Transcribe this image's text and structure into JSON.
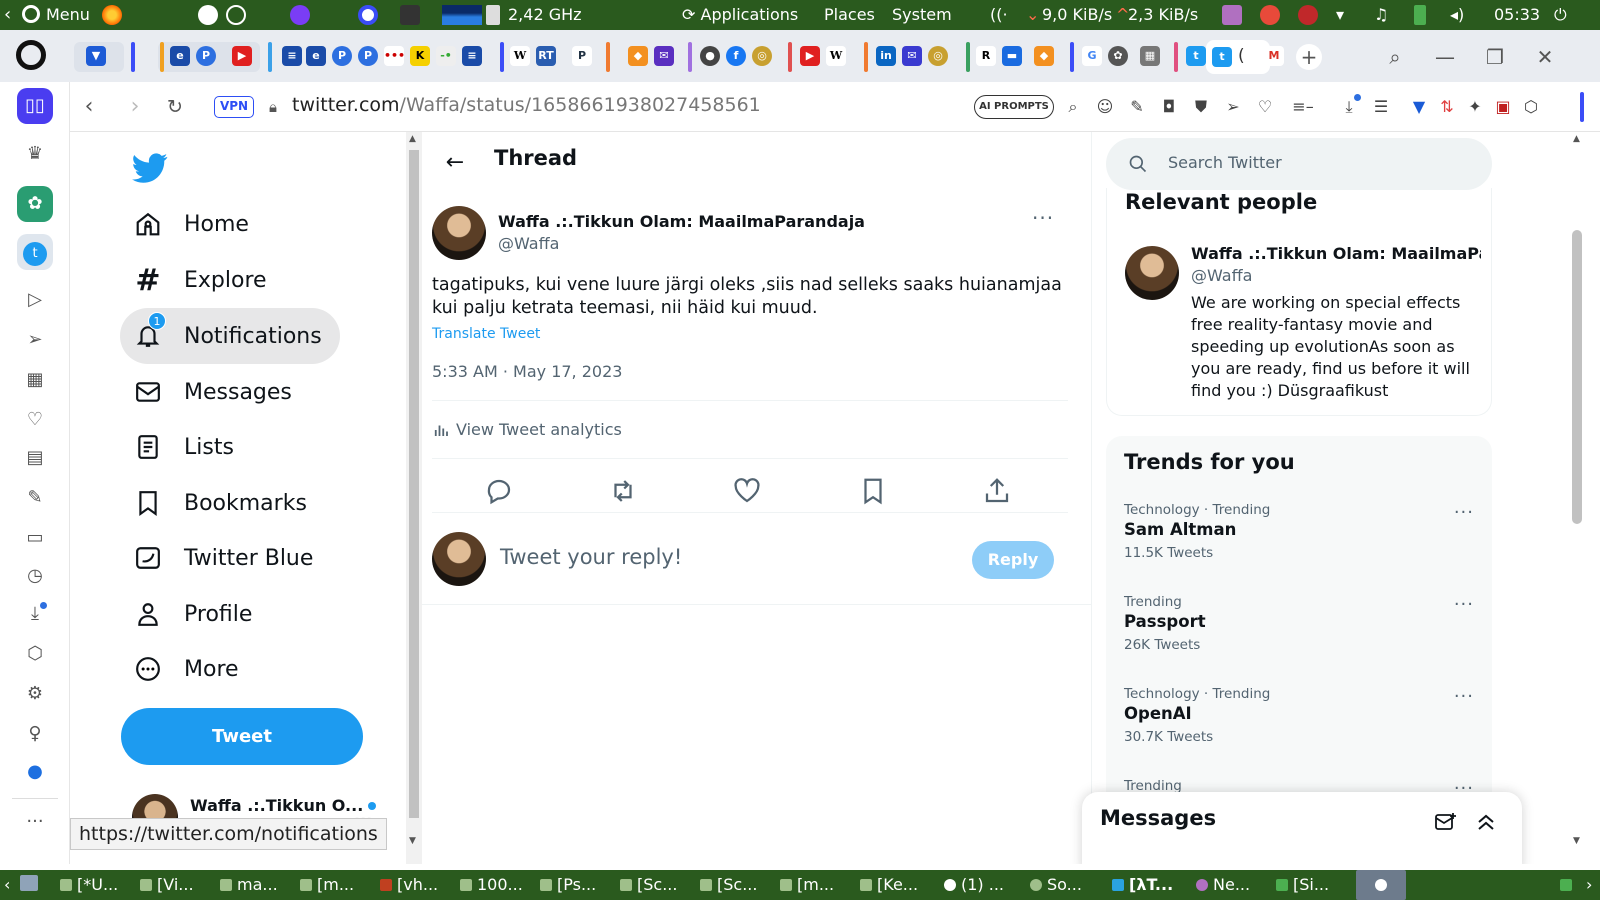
{
  "system_panel": {
    "menu_label": "Menu",
    "cpu_freq": "2,42 GHz",
    "applications": "Applications",
    "places": "Places",
    "system": "System",
    "net_down": "9,0 KiB/s",
    "net_up": "2,3 KiB/s",
    "clock": "05:33"
  },
  "browser": {
    "vpn_label": "VPN",
    "url_host": "twitter.com",
    "url_path": "/Waffa/status/1658661938027458561",
    "ai_prompts_label": "AI PROMPTS",
    "active_tab_label": "("
  },
  "twitter": {
    "nav": [
      {
        "label": "Home",
        "icon": "home-icon"
      },
      {
        "label": "Explore",
        "icon": "hashtag-icon"
      },
      {
        "label": "Notifications",
        "icon": "bell-icon",
        "badge": "1"
      },
      {
        "label": "Messages",
        "icon": "envelope-icon"
      },
      {
        "label": "Lists",
        "icon": "list-icon"
      },
      {
        "label": "Bookmarks",
        "icon": "bookmark-icon"
      },
      {
        "label": "Twitter Blue",
        "icon": "twitter-blue-icon"
      },
      {
        "label": "Profile",
        "icon": "person-icon"
      },
      {
        "label": "More",
        "icon": "more-circle-icon"
      }
    ],
    "tweet_button": "Tweet",
    "account_name": "Waffa .:.Tikkun O...",
    "account_more": "...",
    "status_url": "https://twitter.com/notifications",
    "thread": {
      "title": "Thread",
      "author_name": "Waffa .:.Tikkun Olam: MaailmaParandaja",
      "author_handle": "@Waffa",
      "more": "···",
      "text": "tagatipuks, kui vene luure järgi oleks ,siis nad selleks saaks huianamjaa kui palju ketrata teemasi, nii häid kui muud.",
      "translate": "Translate Tweet",
      "timestamp": "5:33 AM · May 17, 2023",
      "analytics": "View Tweet analytics",
      "reply_placeholder": "Tweet your reply!",
      "reply_button": "Reply"
    },
    "search_placeholder": "Search Twitter",
    "relevant_people": {
      "heading": "Relevant people",
      "name": "Waffa .:.Tikkun Olam: MaailmaPar...",
      "handle": "@Waffa",
      "bio": "We are working on special effects free reality-fantasy movie and speeding up evolutionAs soon as you are ready, find us before it will find you :) Düsgraafikust"
    },
    "trends": {
      "heading": "Trends for you",
      "items": [
        {
          "context": "Technology · Trending",
          "name": "Sam Altman",
          "count": "11.5K Tweets"
        },
        {
          "context": "Trending",
          "name": "Passport",
          "count": "26K Tweets"
        },
        {
          "context": "Technology · Trending",
          "name": "OpenAI",
          "count": "30.7K Tweets"
        },
        {
          "context": "Trending",
          "name": "",
          "count": ""
        }
      ],
      "dots": "···"
    },
    "messages_drawer": "Messages"
  },
  "taskbar": {
    "tasks": [
      "[*U...",
      "[Vi...",
      "ma...",
      "[m...",
      "[vh...",
      "100...",
      "[Ps...",
      "[Sc...",
      "[Sc...",
      "[m...",
      "[Ke...",
      "(1) ...",
      "So...",
      "[λT...",
      "Ne...",
      "[Si..."
    ]
  },
  "colors": {
    "twitter_blue": "#1d9bf0",
    "panel_green": "#2a5a1e",
    "reply_disabled": "#8ecdf8"
  }
}
